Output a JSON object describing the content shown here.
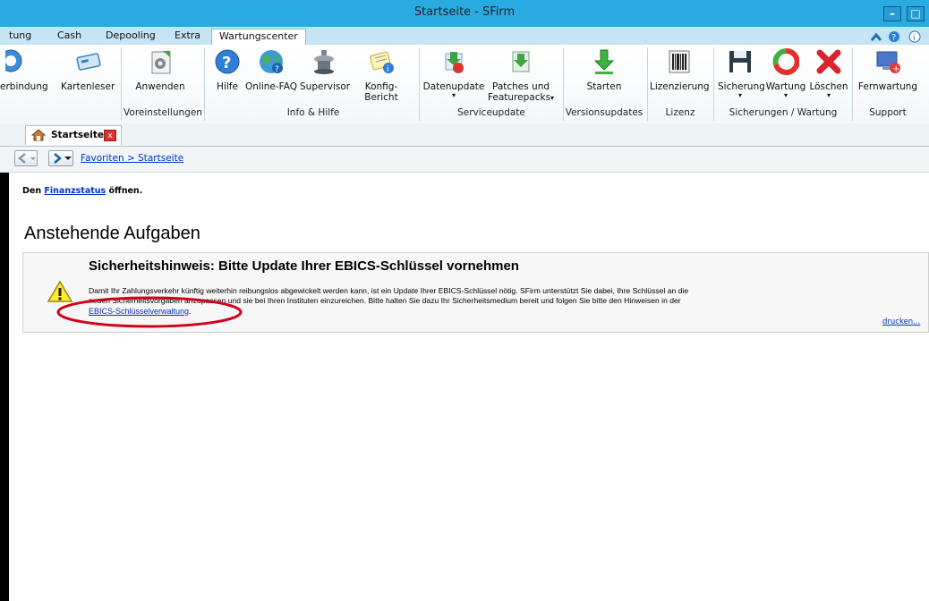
{
  "window": {
    "title": "Startseite - SFirm",
    "min_label": "–",
    "max_label": "□"
  },
  "ribbon_tabs": [
    "tung",
    "Cash",
    "Depooling",
    "Extra",
    "Wartungscenter"
  ],
  "ribbon_buttons": {
    "verbindung": "erbindung",
    "kartenleser": "Kartenleser",
    "anwenden": "Anwenden",
    "hilfe": "Hilfe",
    "online_faq": "Online-FAQ",
    "supervisor": "Supervisor",
    "konfig": "Konfig-Bericht",
    "datenupdate": "Datenupdate",
    "patches_1": "Patches und",
    "patches_2": "Featurepacks",
    "starten": "Starten",
    "lizenzierung": "Lizenzierung",
    "sicherung": "Sicherung",
    "wartung": "Wartung",
    "loeschen": "Löschen",
    "fernwartung": "Fernwartung"
  },
  "ribbon_groups": {
    "voreinstellungen": "Voreinstellungen",
    "info_hilfe": "Info & Hilfe",
    "serviceupdate": "Serviceupdate",
    "versionsupdates": "Versionsupdates",
    "lizenz": "Lizenz",
    "sicherungen": "Sicherungen / Wartung",
    "support": "Support"
  },
  "page_tab": {
    "label": "Startseite",
    "close": "x"
  },
  "breadcrumb": "Favoriten > Startseite",
  "finanz": {
    "prefix": "Den ",
    "link": "Finanzstatus",
    "suffix": " öffnen."
  },
  "section_title": "Anstehende Aufgaben",
  "notice": {
    "title": "Sicherheitshinweis: Bitte Update Ihrer EBICS-Schlüssel vornehmen",
    "line1": "Damit Ihr Zahlungsverkehr künftig weiterhin reibungslos abgewickelt werden kann, ist ein Update Ihrer EBICS-Schlüssel nötig. SFirm unterstützt Sie dabei, Ihre Schlüssel an die",
    "line2": "neuen Sicherheitsvorgaben anzupassen und sie bei Ihren Instituten einzureichen. Bitte halten Sie dazu Ihr Sicherheitsmedium bereit und folgen Sie bitte den Hinweisen in der",
    "link": "EBICS-Schlüsselverwaltung",
    "link_suffix": ".",
    "print": "drucken..."
  },
  "colors": {
    "titlebar": "#29abe2",
    "ribbon_tabs": "#c5e5f5",
    "highlight": "#d0021b",
    "link": "#0033cc"
  }
}
